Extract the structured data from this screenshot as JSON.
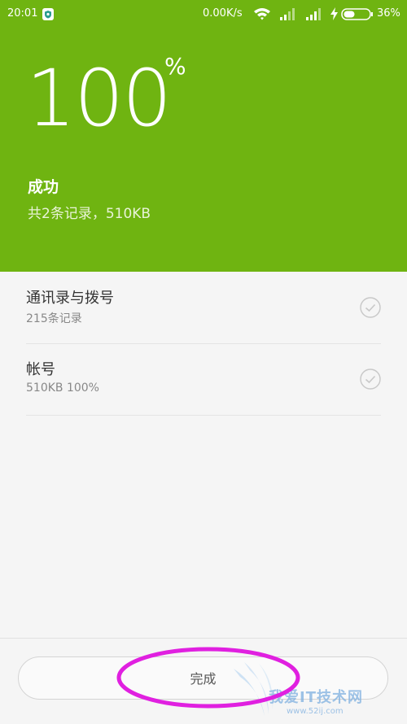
{
  "status_bar": {
    "time": "20:01",
    "speed": "0.00K/s",
    "battery_percent": "36%",
    "icons": [
      "shield-icon",
      "wifi-icon",
      "signal-icon",
      "signal-icon",
      "charging-icon",
      "battery-icon"
    ]
  },
  "hero": {
    "progress_value": "100",
    "progress_unit": "%",
    "status_title": "成功",
    "summary": "共2条记录，510KB",
    "background_color": "#6fb411"
  },
  "items": [
    {
      "title": "通讯录与拨号",
      "subtitle": "215条记录",
      "icon": "check-circle-icon"
    },
    {
      "title": "帐号",
      "subtitle": "510KB 100%",
      "icon": "check-circle-icon"
    }
  ],
  "footer": {
    "done_label": "完成"
  },
  "watermark": {
    "text": "我爱IT技术网",
    "url": "www.52ij.com"
  }
}
